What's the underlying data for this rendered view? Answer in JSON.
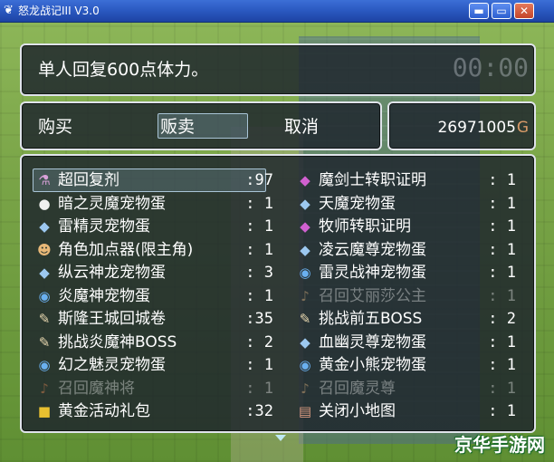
{
  "window": {
    "title": "怒龙战记III V3.0",
    "minimize": "▬",
    "maximize": "▭",
    "close": "✕"
  },
  "help": {
    "text": "单人回复600点体力。",
    "clock": "00:00"
  },
  "commands": [
    {
      "label": "购买"
    },
    {
      "label": "贩卖"
    },
    {
      "label": "取消"
    }
  ],
  "gold": {
    "amount": "26971005",
    "unit": "G"
  },
  "items_left": [
    {
      "icon": "potion-icon",
      "glyph": "⚗",
      "color": "#d8a0d8",
      "name": "超回复剂",
      "count": ":97",
      "enabled": true
    },
    {
      "icon": "egg-icon",
      "glyph": "●",
      "color": "#f0f0f0",
      "name": "暗之灵魔宠物蛋",
      "count": ": 1",
      "enabled": true
    },
    {
      "icon": "crystal-egg-icon",
      "glyph": "◆",
      "color": "#9cc8f0",
      "name": "雷精灵宠物蛋",
      "count": ": 1",
      "enabled": true
    },
    {
      "icon": "character-icon",
      "glyph": "☻",
      "color": "#e8b878",
      "name": "角色加点器(限主角)",
      "count": ": 1",
      "enabled": true
    },
    {
      "icon": "crystal-egg-icon",
      "glyph": "◆",
      "color": "#9cc8f0",
      "name": "纵云神龙宠物蛋",
      "count": ": 3",
      "enabled": true
    },
    {
      "icon": "orb-icon",
      "glyph": "◉",
      "color": "#6ab0f0",
      "name": "炎魔神宠物蛋",
      "count": ": 1",
      "enabled": true
    },
    {
      "icon": "scroll-icon",
      "glyph": "✎",
      "color": "#e8d8b0",
      "name": "斯隆王城回城卷",
      "count": ":35",
      "enabled": true
    },
    {
      "icon": "scroll-icon",
      "glyph": "✎",
      "color": "#e8d8b0",
      "name": "挑战炎魔神BOSS",
      "count": ": 2",
      "enabled": true
    },
    {
      "icon": "orb-icon",
      "glyph": "◉",
      "color": "#6ab0f0",
      "name": "幻之魅灵宠物蛋",
      "count": ": 1",
      "enabled": true
    },
    {
      "icon": "summon-icon",
      "glyph": "♪",
      "color": "#d08050",
      "name": "召回魔神将",
      "count": ": 1",
      "enabled": false
    },
    {
      "icon": "treasure-icon",
      "glyph": "■",
      "color": "#e8c030",
      "name": "黄金活动礼包",
      "count": ":32",
      "enabled": true
    }
  ],
  "items_right": [
    {
      "icon": "diamond-icon",
      "glyph": "◆",
      "color": "#d060d0",
      "name": "魔剑士转职证明",
      "count": ": 1",
      "enabled": true
    },
    {
      "icon": "crystal-egg-icon",
      "glyph": "◆",
      "color": "#9cc8f0",
      "name": "天魔宠物蛋",
      "count": ": 1",
      "enabled": true
    },
    {
      "icon": "diamond-icon",
      "glyph": "◆",
      "color": "#d060d0",
      "name": "牧师转职证明",
      "count": ": 1",
      "enabled": true
    },
    {
      "icon": "crystal-egg-icon",
      "glyph": "◆",
      "color": "#9cc8f0",
      "name": "凌云魔尊宠物蛋",
      "count": ": 1",
      "enabled": true
    },
    {
      "icon": "orb-icon",
      "glyph": "◉",
      "color": "#6ab0f0",
      "name": "雷灵战神宠物蛋",
      "count": ": 1",
      "enabled": true
    },
    {
      "icon": "summon-icon",
      "glyph": "♪",
      "color": "#d0a878",
      "name": "召回艾丽莎公主",
      "count": ": 1",
      "enabled": false
    },
    {
      "icon": "scroll-icon",
      "glyph": "✎",
      "color": "#e8d8b0",
      "name": "挑战前五BOSS",
      "count": ": 2",
      "enabled": true
    },
    {
      "icon": "crystal-egg-icon",
      "glyph": "◆",
      "color": "#9cc8f0",
      "name": "血幽灵尊宠物蛋",
      "count": ": 1",
      "enabled": true
    },
    {
      "icon": "orb-icon",
      "glyph": "◉",
      "color": "#6ab0f0",
      "name": "黄金小熊宠物蛋",
      "count": ": 1",
      "enabled": true
    },
    {
      "icon": "summon-icon",
      "glyph": "♪",
      "color": "#d0a878",
      "name": "召回魔灵尊",
      "count": ": 1",
      "enabled": false
    },
    {
      "icon": "map-icon",
      "glyph": "▤",
      "color": "#d89a80",
      "name": "关闭小地图",
      "count": ": 1",
      "enabled": true
    }
  ],
  "watermark": "京华手游网"
}
